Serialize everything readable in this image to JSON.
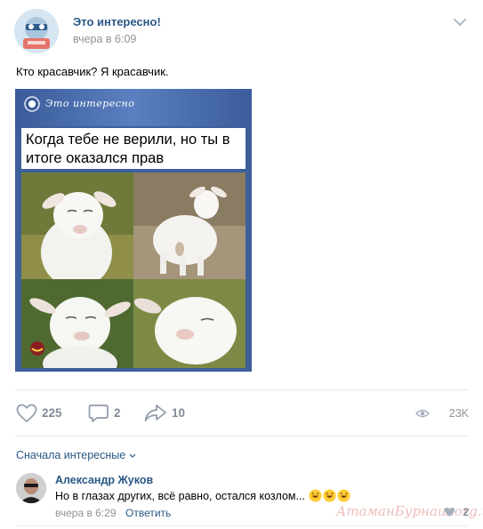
{
  "post": {
    "author": "Это интересно!",
    "date": "вчера в 6:09",
    "text": "Кто красавчик? Я красавчик.",
    "image": {
      "watermark": "Это интересно",
      "caption": "Когда тебе не верили, но ты в итоге оказался прав"
    },
    "actions": {
      "likes": "225",
      "comments": "2",
      "shares": "10",
      "views": "23K"
    }
  },
  "comments_section": {
    "sort_label": "Сначала интересные",
    "comments": [
      {
        "author": "Александр Жуков",
        "text": "Но в глазах других, всё равно, остался козлом...",
        "date": "вчера в 6:29",
        "reply_label": "Ответить",
        "likes": "2"
      }
    ]
  },
  "site_watermark": "АтаманБурнаш.org.ua",
  "colors": {
    "link_blue": "#2a5885",
    "muted_gray": "#939393",
    "action_gray": "#828a99",
    "meme_blue": "#3d5f9b"
  }
}
